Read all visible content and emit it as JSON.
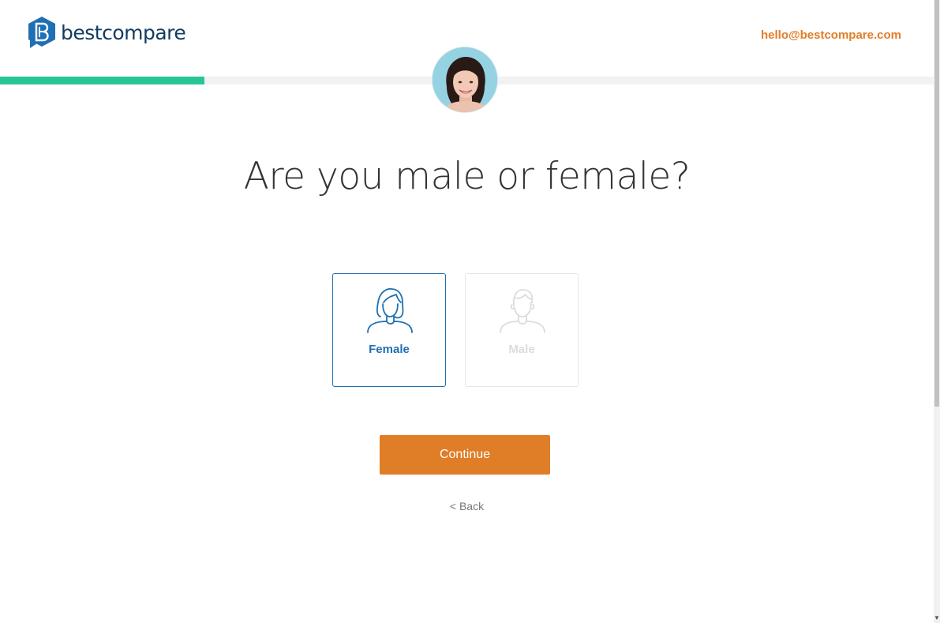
{
  "header": {
    "brand_name": "bestcompare",
    "logo_letter": "B",
    "contact_email": "hello@bestcompare.com"
  },
  "progress": {
    "fraction": 0.219,
    "fill_color": "#27c596",
    "track_color": "#f2f2f2"
  },
  "avatar": {
    "icon": "advisor-photo"
  },
  "question": {
    "text": "Are you male or female?"
  },
  "options": [
    {
      "label": "Female",
      "icon": "female-person-icon",
      "selected": true,
      "color": "#1f6fb4"
    },
    {
      "label": "Male",
      "icon": "male-person-icon",
      "selected": false,
      "color": "#dcdcdc"
    }
  ],
  "actions": {
    "continue_label": "Continue",
    "back_label": "< Back"
  },
  "colors": {
    "accent": "#e07d27",
    "brand_blue": "#1f6fb4",
    "logo_blue": "#123c61"
  }
}
